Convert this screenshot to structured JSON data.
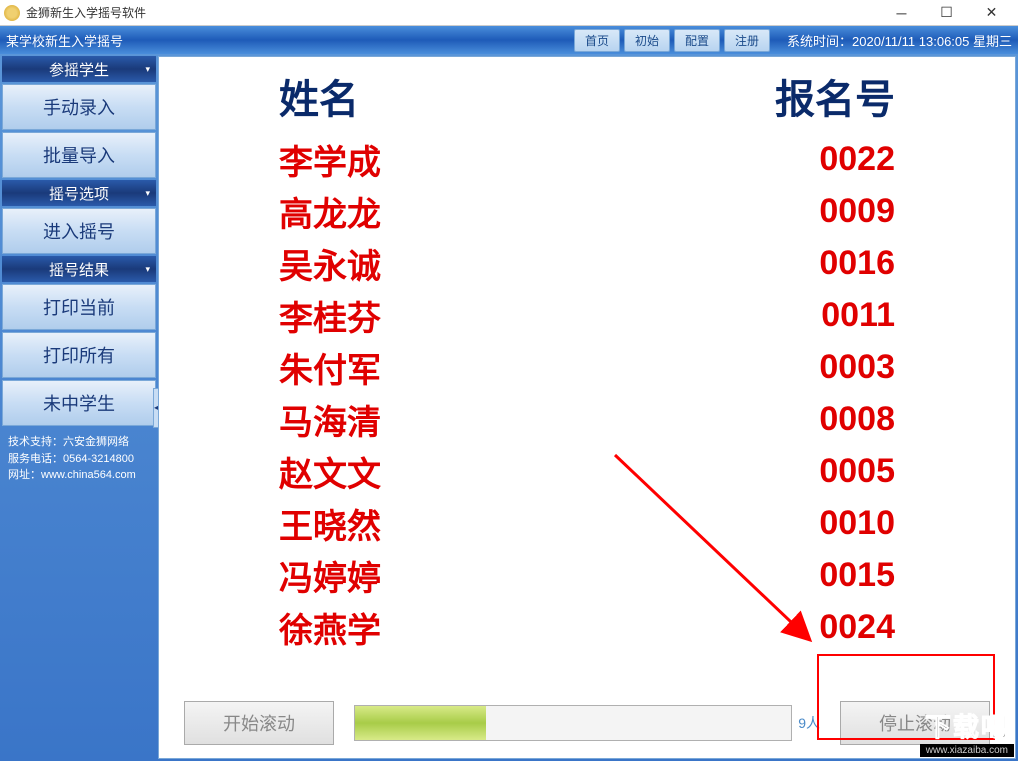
{
  "window": {
    "title": "金狮新生入学摇号软件",
    "subtitle": "某学校新生入学摇号",
    "menu": {
      "home": "首页",
      "init": "初始",
      "config": "配置",
      "register": "注册"
    },
    "systime_label": "系统时间：",
    "systime": "2020/11/11 13:06:05 星期三"
  },
  "sidebar": {
    "section1": {
      "header": "参摇学生",
      "btn1": "手动录入",
      "btn2": "批量导入"
    },
    "section2": {
      "header": "摇号选项",
      "btn1": "进入摇号"
    },
    "section3": {
      "header": "摇号结果",
      "btn1": "打印当前",
      "btn2": "打印所有",
      "btn3": "未中学生"
    },
    "support": {
      "l1": "技术支持：六安金狮网络",
      "l2": "服务电话：0564-3214800",
      "l3": "网址：www.china564.com"
    }
  },
  "table": {
    "col_name": "姓名",
    "col_number": "报名号",
    "rows": [
      {
        "name": "李学成",
        "num": "0022"
      },
      {
        "name": "高龙龙",
        "num": "0009"
      },
      {
        "name": "吴永诚",
        "num": "0016"
      },
      {
        "name": "李桂芬",
        "num": "0011"
      },
      {
        "name": "朱付军",
        "num": "0003"
      },
      {
        "name": "马海清",
        "num": "0008"
      },
      {
        "name": "赵文文",
        "num": "0005"
      },
      {
        "name": "王晓然",
        "num": "0010"
      },
      {
        "name": "冯婷婷",
        "num": "0015"
      },
      {
        "name": "徐燕学",
        "num": "0024"
      }
    ]
  },
  "controls": {
    "start": "开始滚动",
    "stop": "停止滚动",
    "progress_label": "9人"
  },
  "watermark": {
    "big": "下载吧",
    "small": "www.xiazaiba.com"
  }
}
